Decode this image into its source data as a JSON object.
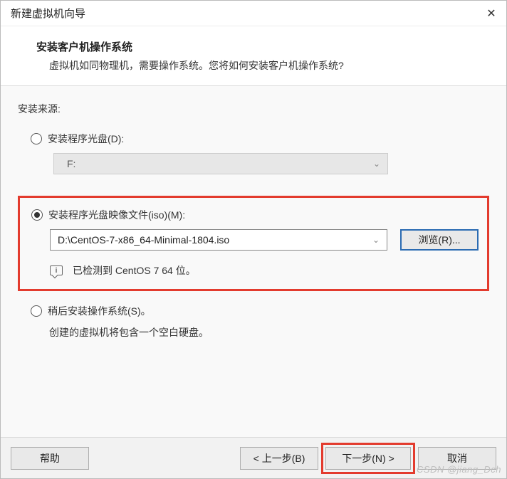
{
  "titlebar": {
    "title": "新建虚拟机向导",
    "close_icon": "✕"
  },
  "header": {
    "title": "安装客户机操作系统",
    "description": "虚拟机如同物理机，需要操作系统。您将如何安装客户机操作系统?"
  },
  "content": {
    "source_label": "安装来源:",
    "option_disc": {
      "label": "安装程序光盘(D):",
      "drive_value": "F:"
    },
    "option_iso": {
      "label": "安装程序光盘映像文件(iso)(M):",
      "path": "D:\\CentOS-7-x86_64-Minimal-1804.iso",
      "browse_label": "浏览(R)...",
      "detect_text": "已检测到 CentOS 7 64 位。",
      "info_glyph": "i"
    },
    "option_later": {
      "label": "稍后安装操作系统(S)。",
      "description": "创建的虚拟机将包含一个空白硬盘。"
    }
  },
  "footer": {
    "help": "帮助",
    "back": "< 上一步(B)",
    "next": "下一步(N) >",
    "cancel": "取消"
  },
  "watermark": "CSDN @jiang_Dch"
}
